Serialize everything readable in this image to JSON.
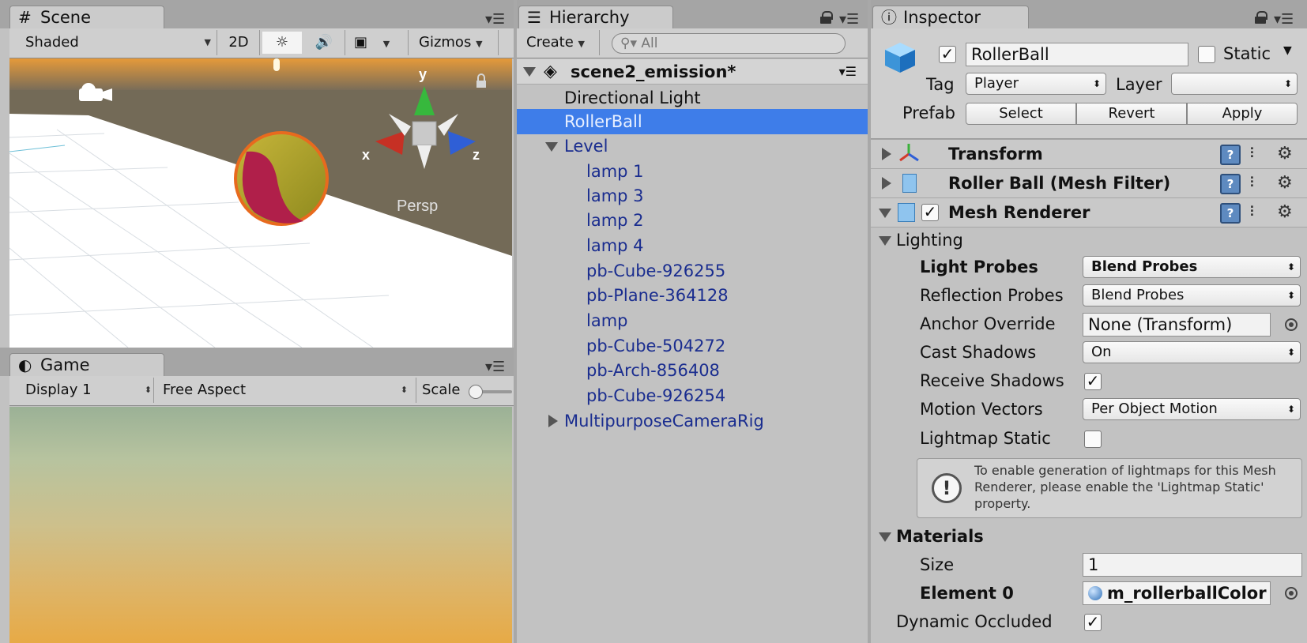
{
  "scene": {
    "tab": "Scene",
    "shading": "Shaded",
    "mode_2d": "2D",
    "gizmos": "Gizmos",
    "gizmo_axes": {
      "y": "y",
      "x": "x",
      "z": "z"
    },
    "persp": "Persp"
  },
  "game": {
    "tab": "Game",
    "display": "Display 1",
    "aspect": "Free Aspect",
    "scale_label": "Scale",
    "scale_value": 0.05
  },
  "hierarchy": {
    "tab": "Hierarchy",
    "create": "Create",
    "search_placeholder": "All",
    "scene_name": "scene2_emission*",
    "items": [
      {
        "label": "Directional Light"
      },
      {
        "label": "RollerBall"
      },
      {
        "label": "Level"
      },
      {
        "label": "lamp 1"
      },
      {
        "label": "lamp 3"
      },
      {
        "label": "lamp 2"
      },
      {
        "label": "lamp 4"
      },
      {
        "label": "pb-Cube-926255"
      },
      {
        "label": "pb-Plane-364128"
      },
      {
        "label": "lamp"
      },
      {
        "label": "pb-Cube-504272"
      },
      {
        "label": "pb-Arch-856408"
      },
      {
        "label": "pb-Cube-926254"
      },
      {
        "label": "MultipurposeCameraRig"
      }
    ]
  },
  "inspector": {
    "tab": "Inspector",
    "object_name": "RollerBall",
    "static_label": "Static",
    "tag_label": "Tag",
    "tag_value": "Player",
    "layer_label": "Layer",
    "layer_value": "",
    "prefab_label": "Prefab",
    "prefab_select": "Select",
    "prefab_revert": "Revert",
    "prefab_apply": "Apply",
    "components": {
      "transform": "Transform",
      "mesh_filter": "Roller Ball (Mesh Filter)",
      "mesh_renderer": "Mesh Renderer"
    },
    "lighting": {
      "header": "Lighting",
      "light_probes_label": "Light Probes",
      "light_probes_value": "Blend Probes",
      "reflection_probes_label": "Reflection Probes",
      "reflection_probes_value": "Blend Probes",
      "anchor_override_label": "Anchor Override",
      "anchor_override_value": "None (Transform)",
      "cast_shadows_label": "Cast Shadows",
      "cast_shadows_value": "On",
      "receive_shadows_label": "Receive Shadows",
      "motion_vectors_label": "Motion Vectors",
      "motion_vectors_value": "Per Object Motion",
      "lightmap_static_label": "Lightmap Static",
      "lightmap_help": "To enable generation of lightmaps for this Mesh Renderer, please enable the 'Lightmap Static' property."
    },
    "materials": {
      "header": "Materials",
      "size_label": "Size",
      "size_value": "1",
      "element0_label": "Element 0",
      "element0_value": "m_rollerballColor"
    },
    "dynamic_occluded_label": "Dynamic Occluded"
  }
}
